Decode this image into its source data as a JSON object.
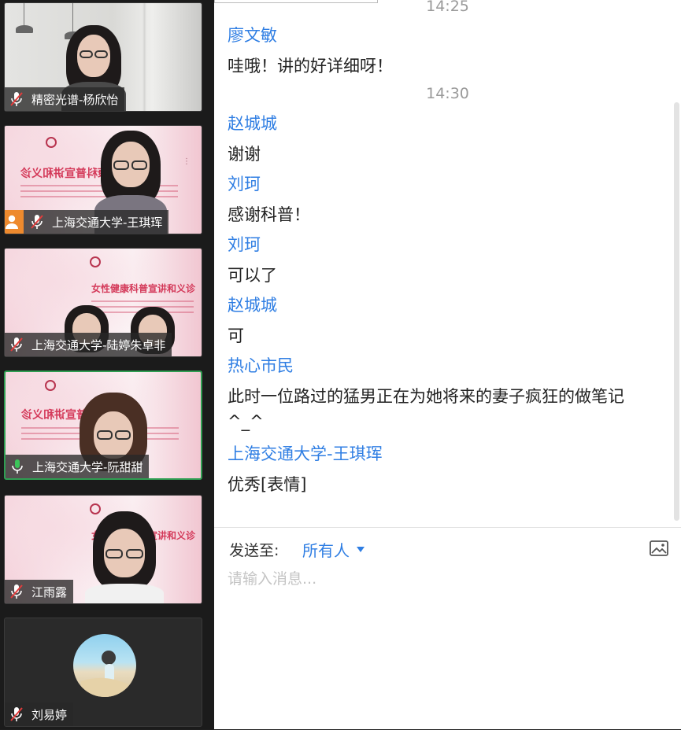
{
  "participants": [
    {
      "name": "精密光谱-杨欣怡",
      "mic": "muted",
      "active": false
    },
    {
      "name": "上海交通大学-王琪珲",
      "mic": "muted",
      "active": false,
      "badge": "user-icon"
    },
    {
      "name": "上海交通大学-陆婷朱卓非",
      "mic": "muted",
      "active": false
    },
    {
      "name": "上海交通大学-阮甜甜",
      "mic": "on",
      "active": true
    },
    {
      "name": "江雨露",
      "mic": "muted",
      "active": false
    },
    {
      "name": "刘易婷",
      "mic": "muted",
      "active": false
    }
  ],
  "poster": {
    "title": "女性健康科普宣讲和义诊"
  },
  "chat": {
    "items": [
      {
        "kind": "time",
        "text": "14:25"
      },
      {
        "kind": "sender",
        "text": "廖文敏"
      },
      {
        "kind": "msg",
        "text": "哇哦！讲的好详细呀！"
      },
      {
        "kind": "time",
        "text": "14:30"
      },
      {
        "kind": "sender",
        "text": "赵城城"
      },
      {
        "kind": "msg",
        "text": "谢谢"
      },
      {
        "kind": "sender",
        "text": "刘珂"
      },
      {
        "kind": "msg",
        "text": "感谢科普！"
      },
      {
        "kind": "sender",
        "text": "刘珂"
      },
      {
        "kind": "msg",
        "text": "可以了"
      },
      {
        "kind": "sender",
        "text": "赵城城"
      },
      {
        "kind": "msg",
        "text": "可"
      },
      {
        "kind": "sender",
        "text": "热心市民"
      },
      {
        "kind": "msg",
        "text": "此时一位路过的猛男正在为她将来的妻子疯狂的做笔记"
      },
      {
        "kind": "msg",
        "text": "^_^"
      },
      {
        "kind": "sender",
        "text": "上海交通大学-王琪珲"
      },
      {
        "kind": "msg",
        "text": "优秀[表情]"
      }
    ],
    "send_to_label": "发送至:",
    "recipient": "所有人",
    "input_placeholder": "请输入消息..."
  },
  "colors": {
    "sender": "#2f7ee3",
    "active_border": "#2f9e52",
    "badge": "#ee8a2e",
    "muted_mic": "#e23c3c",
    "active_mic": "#3cc45a"
  }
}
